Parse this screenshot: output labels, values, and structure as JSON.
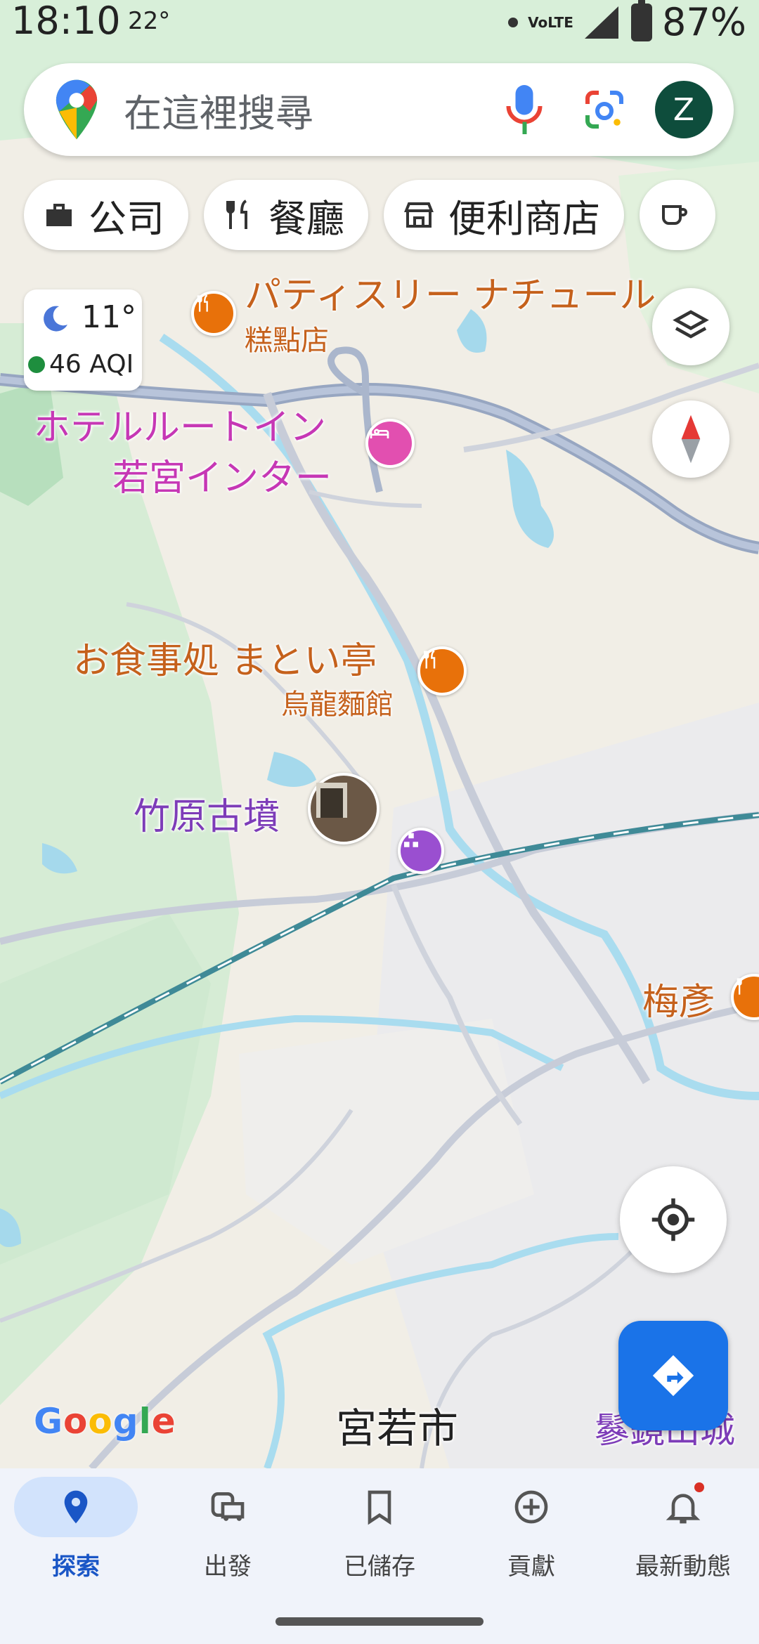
{
  "status_bar": {
    "time": "18:10",
    "temperature": "22°",
    "battery": "87%",
    "network": "VoLTE"
  },
  "search": {
    "placeholder": "在這裡搜尋",
    "avatar_letter": "Z"
  },
  "chips": [
    {
      "label": "公司",
      "icon": "briefcase-icon"
    },
    {
      "label": "餐廳",
      "icon": "fork-knife-icon"
    },
    {
      "label": "便利商店",
      "icon": "store-icon"
    }
  ],
  "weather": {
    "temp": "11°",
    "aqi": "46 AQI"
  },
  "map_labels": {
    "patisserie": "パティスリー ナチュール",
    "patisserie_sub": "糕點店",
    "hotel_line1": "ホテルルートイン",
    "hotel_line2": "若宮インター",
    "restaurant": "お食事処 まとい亭",
    "restaurant_sub": "烏龍麵館",
    "kofun": "竹原古墳",
    "umehiko": "梅彥",
    "city": "宮若市",
    "castle": "鬖鏡山城"
  },
  "brand": {
    "google": "Google"
  },
  "bottom_nav": [
    {
      "label": "探索",
      "icon": "location-pin-icon",
      "active": true
    },
    {
      "label": "出發",
      "icon": "commute-icon",
      "active": false
    },
    {
      "label": "已儲存",
      "icon": "bookmark-icon",
      "active": false
    },
    {
      "label": "貢獻",
      "icon": "add-circle-icon",
      "active": false
    },
    {
      "label": "最新動態",
      "icon": "bell-icon",
      "active": false,
      "badge": true
    }
  ],
  "colors": {
    "accent": "#1a73e8",
    "avatar_bg": "#0e4d3c",
    "poi_food": "#e8710a",
    "poi_hotel": "#e24fb0",
    "poi_attraction": "#9a4fd0"
  }
}
